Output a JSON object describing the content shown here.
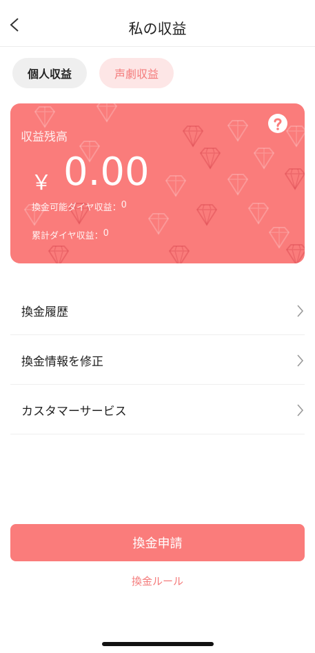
{
  "header": {
    "title": "私の収益",
    "back_icon": "chevron-left-icon"
  },
  "tabs": [
    {
      "label": "個人収益",
      "state": "inactive"
    },
    {
      "label": "声劇収益",
      "state": "active"
    }
  ],
  "card": {
    "label": "収益残高",
    "currency": "￥",
    "balance": "0.00",
    "exchangeable_label": "換金可能ダイヤ収益：",
    "exchangeable_value": "0",
    "cumulative_label": "累計ダイヤ収益：",
    "cumulative_value": "0",
    "help_icon": "question-icon",
    "background_color": "#fa7c7b",
    "decoration_icon": "diamond-icon"
  },
  "menu": [
    {
      "label": "換金履歴",
      "icon": "chevron-right-icon"
    },
    {
      "label": "換金情報を修正",
      "icon": "chevron-right-icon"
    },
    {
      "label": "カスタマーサービス",
      "icon": "chevron-right-icon"
    }
  ],
  "footer": {
    "withdraw_button": "換金申請",
    "rules_link": "換金ルール"
  },
  "colors": {
    "accent": "#fa7c7b",
    "accent_text": "#f47a7a",
    "tab_active_bg": "#fde6e6"
  }
}
